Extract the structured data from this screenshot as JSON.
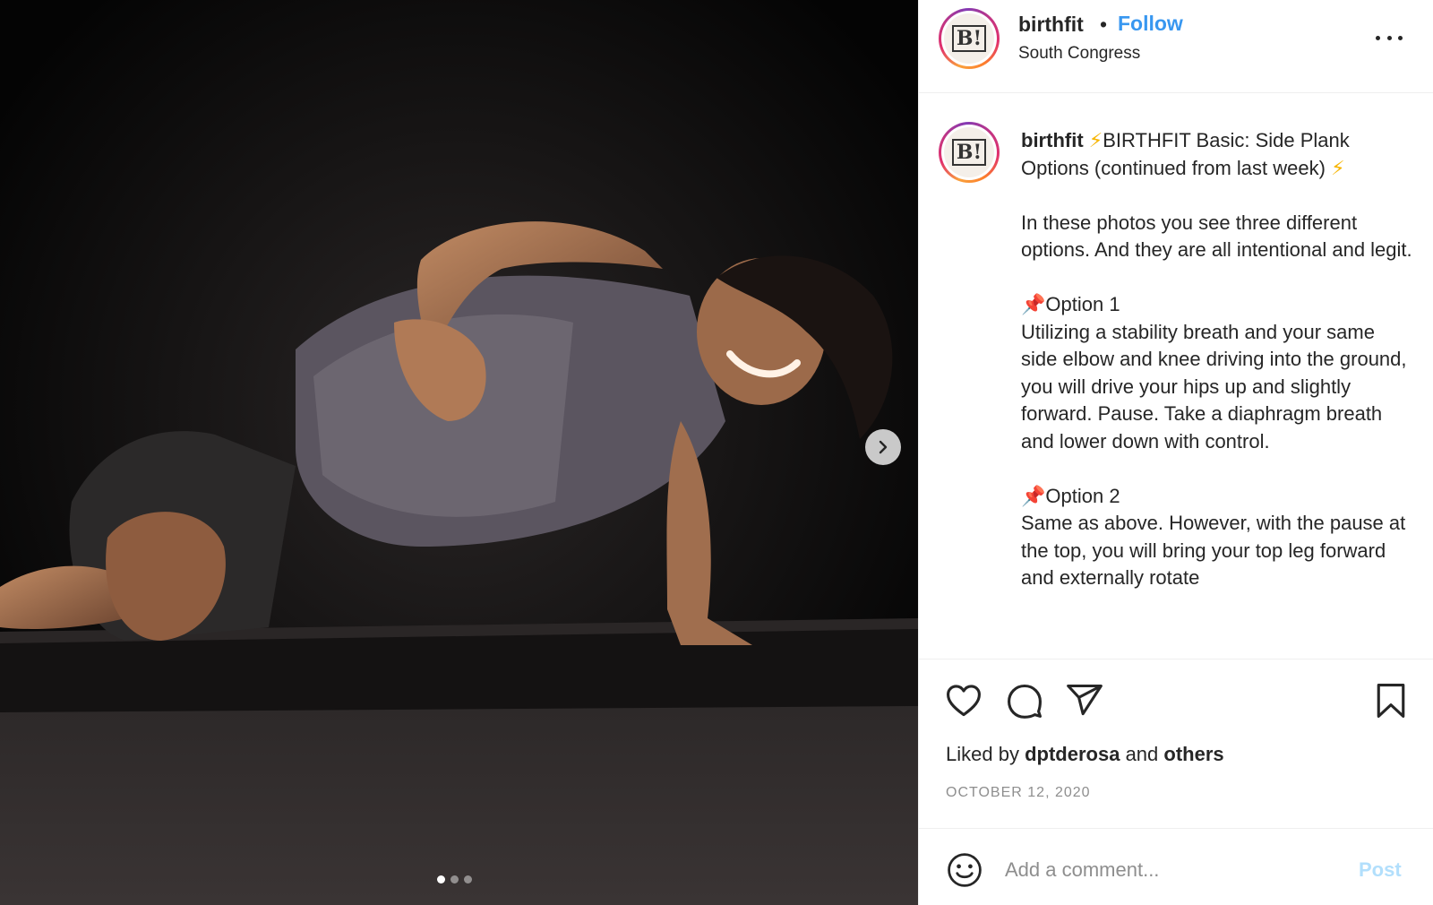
{
  "post": {
    "username": "birthfit",
    "separator": "•",
    "follow_label": "Follow",
    "location": "South Congress",
    "avatar_logo": "B!",
    "carousel": {
      "slide_count": 3,
      "active_index": 0
    }
  },
  "caption": {
    "username": "birthfit",
    "title_line": "BIRTHFIT Basic: Side Plank Options (continued from last week)",
    "para1": "In these photos you see three different options. And they are all intentional and legit.",
    "option1_title": "Option 1",
    "option1_body": "Utilizing a stability breath and your same side elbow and knee driving into the ground, you will drive your hips up and slightly forward. Pause. Take a diaphragm breath and lower down with control.",
    "option2_title": "Option 2",
    "option2_body": "Same as above. However, with the pause at the top, you will bring your top leg forward and externally rotate"
  },
  "actions": {
    "liked_by_prefix": "Liked by",
    "liked_by_user": "dptderosa",
    "liked_by_and": "and",
    "liked_by_others": "others",
    "date": "OCTOBER 12, 2020"
  },
  "comment": {
    "placeholder": "Add a comment...",
    "post_label": "Post"
  },
  "icons": {
    "heart": "heart-icon",
    "comment": "comment-icon",
    "share": "share-icon",
    "save": "bookmark-icon",
    "emoji": "emoji-icon",
    "more": "more-icon",
    "next": "chevron-right-icon"
  },
  "colors": {
    "follow": "#3897f0",
    "post_disabled": "#b2dffc",
    "muted": "#8e8e8e"
  }
}
